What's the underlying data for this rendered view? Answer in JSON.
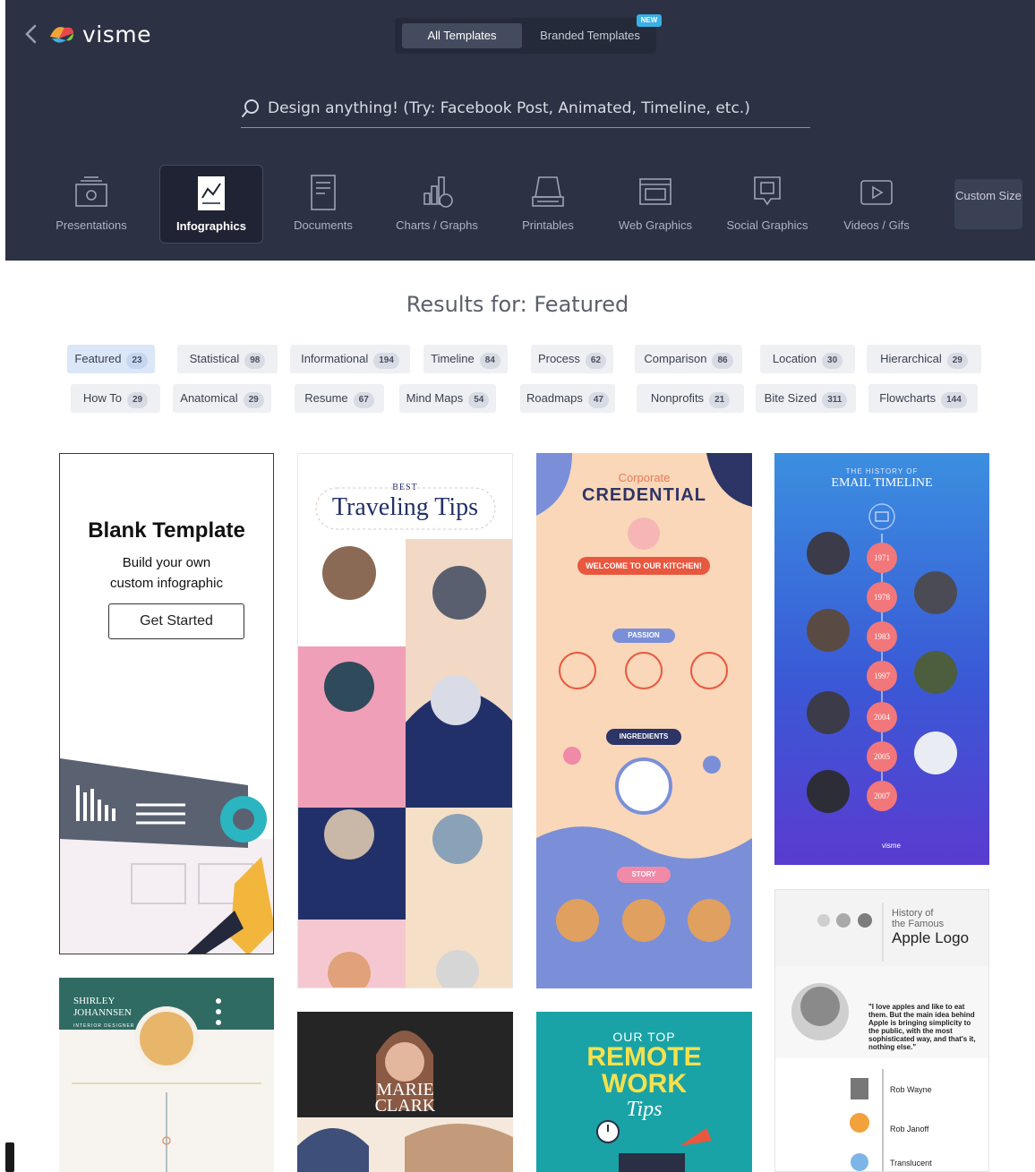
{
  "header": {
    "logo_text": "visme",
    "tabs": {
      "all": "All Templates",
      "branded": "Branded Templates",
      "new_badge": "NEW"
    },
    "search_placeholder": "Design anything! (Try: Facebook Post, Animated, Timeline, etc.)",
    "categories": [
      {
        "label": "Presentations",
        "icon": "presentation-icon"
      },
      {
        "label": "Infographics",
        "icon": "infographic-icon"
      },
      {
        "label": "Documents",
        "icon": "document-icon"
      },
      {
        "label": "Charts / Graphs",
        "icon": "chart-icon"
      },
      {
        "label": "Printables",
        "icon": "printer-icon"
      },
      {
        "label": "Web Graphics",
        "icon": "web-graphic-icon"
      },
      {
        "label": "Social Graphics",
        "icon": "social-icon"
      },
      {
        "label": "Videos / Gifs",
        "icon": "video-icon"
      }
    ],
    "custom_size": "Custom Size",
    "accent": "#2c3144"
  },
  "results": {
    "title": "Results for: Featured",
    "chips_row1": [
      {
        "label": "Featured",
        "count": "23"
      },
      {
        "label": "Statistical",
        "count": "98"
      },
      {
        "label": "Informational",
        "count": "194"
      },
      {
        "label": "Timeline",
        "count": "84"
      },
      {
        "label": "Process",
        "count": "62"
      },
      {
        "label": "Comparison",
        "count": "86"
      },
      {
        "label": "Location",
        "count": "30"
      },
      {
        "label": "Hierarchical",
        "count": "29"
      }
    ],
    "chips_row2": [
      {
        "label": "How To",
        "count": "29"
      },
      {
        "label": "Anatomical",
        "count": "29"
      },
      {
        "label": "Resume",
        "count": "67"
      },
      {
        "label": "Mind Maps",
        "count": "54"
      },
      {
        "label": "Roadmaps",
        "count": "47"
      },
      {
        "label": "Nonprofits",
        "count": "21"
      },
      {
        "label": "Bite Sized",
        "count": "311"
      },
      {
        "label": "Flowcharts",
        "count": "144"
      }
    ]
  },
  "cards": {
    "blank": {
      "title": "Blank Template",
      "subtitle_1": "Build your own",
      "subtitle_2": "custom infographic",
      "button": "Get Started"
    },
    "traveling": {
      "best": "BEST",
      "title": "Traveling Tips"
    },
    "credential": {
      "top": "Corporate",
      "main": "CREDENTIAL",
      "welcome": "WELCOME TO OUR KITCHEN!",
      "passion": "PASSION",
      "ingredients": "INGREDIENTS",
      "story": "STORY"
    },
    "email": {
      "top": "THE HISTORY OF",
      "main": "EMAIL TIMELINE",
      "years": [
        "1971",
        "1978",
        "1983",
        "1997",
        "2004",
        "2005",
        "2007"
      ],
      "footer": "visme"
    },
    "apple": {
      "history_1": "History of",
      "history_2": "the Famous",
      "main": "Apple Logo",
      "names": [
        "Rob Wayne",
        "Rob Janoff",
        "Translucent"
      ],
      "quote": "\"I love apples and like to eat them. But the main idea behind Apple is bringing simplicity to the public, with the most sophisticated way, and that's it, nothing else.\""
    },
    "shirley": {
      "name_1": "SHIRLEY",
      "name_2": "JOHANNSEN",
      "role": "INTERIOR DESIGNER"
    },
    "marie": {
      "name_1": "MARIE",
      "name_2": "CLARK"
    },
    "remote": {
      "our_top": "OUR TOP",
      "main_1": "REMOTE",
      "main_2": "WORK",
      "tips": "Tips"
    }
  }
}
